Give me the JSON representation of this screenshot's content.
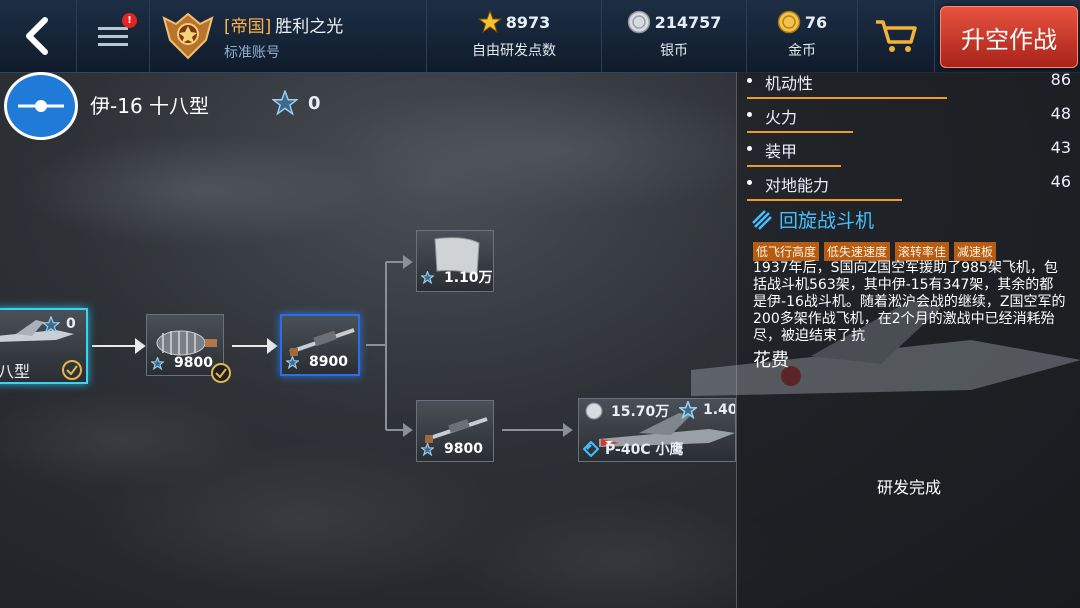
{
  "topbar": {
    "notification_count": "!",
    "player": {
      "faction": "[帝国]",
      "name": "胜利之光",
      "account_type": "标准账号"
    },
    "resources": [
      {
        "icon": "star-icon",
        "value": "8973",
        "label": "自由研发点数"
      },
      {
        "icon": "silver-coin-icon",
        "value": "214757",
        "label": "银币"
      },
      {
        "icon": "gold-coin-icon",
        "value": "76",
        "label": "金币"
      }
    ],
    "launch_label": "升空作战"
  },
  "plane": {
    "name": "伊-16 十八型",
    "points": "0"
  },
  "tree": {
    "current_node": {
      "points": "0",
      "label": "八型"
    },
    "engine_cost": "9800",
    "gun1_cost": "8900",
    "armor_cost": "1.10万",
    "gun2_cost": "9800",
    "next_plane": {
      "silver_cost": "15.70万",
      "points_cost": "1.40",
      "name": "P-40C 小鹰"
    }
  },
  "panel": {
    "stats": [
      {
        "name": "机动性",
        "value": "86",
        "level": 0.58
      },
      {
        "name": "火力",
        "value": "48",
        "level": 0.32
      },
      {
        "name": "装甲",
        "value": "43",
        "level": 0.28
      },
      {
        "name": "对地能力",
        "value": "46",
        "level": 0.48
      }
    ],
    "plane_type": "回旋战斗机",
    "tags": [
      "低飞行高度",
      "低失速速度",
      "滚转率佳",
      "减速板"
    ],
    "description": "1937年后，S国向Z国空军援助了985架飞机，包括战斗机563架，其中伊-15有347架，其余的都是伊-16战斗机。随着淞沪会战的继续，Z国空军的200多架作战飞机，在2个月的激战中已经消耗殆尽，被迫结束了抗",
    "cost_title": "花费",
    "research_status": "研发完成"
  },
  "colors": {
    "accent": "#f09a2e",
    "launch": "#d23a2a",
    "selected": "#38d4f0",
    "type": "#44c0ff"
  }
}
